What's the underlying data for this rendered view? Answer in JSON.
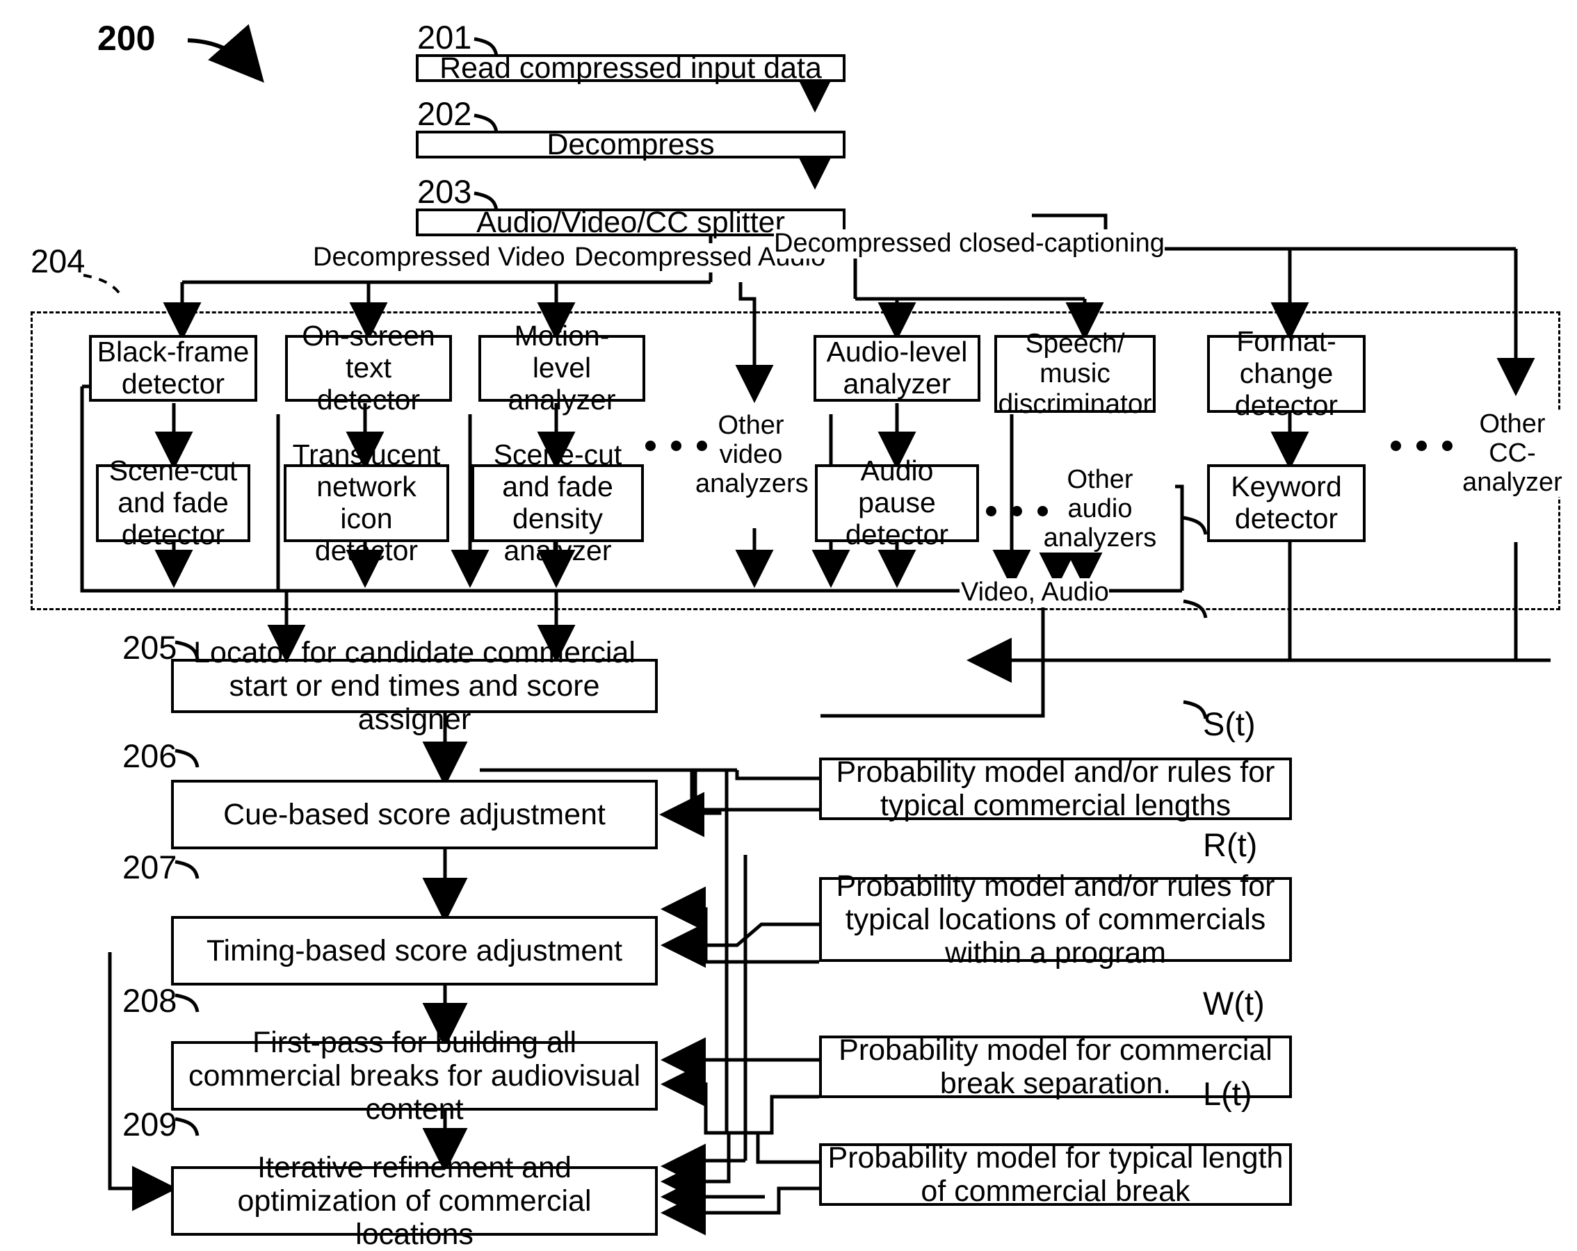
{
  "figure": {
    "number": "200"
  },
  "refs": {
    "r201": "201",
    "r202": "202",
    "r203": "203",
    "r204": "204",
    "r205": "205",
    "r206": "206",
    "r207": "207",
    "r208": "208",
    "r209": "209",
    "st": "S(t)",
    "rt": "R(t)",
    "wt": "W(t)",
    "lt": "L(t)"
  },
  "pipeline": {
    "read": "Read compressed input data",
    "decompress": "Decompress",
    "splitter": "Audio/Video/CC splitter",
    "locator": "Locator for candidate commercial start or end times and score assigner",
    "cue": "Cue-based score adjustment",
    "timing": "Timing-based score adjustment",
    "firstpass": "First-pass for building all commercial breaks for audiovisual content",
    "iterative": "Iterative refinement and optimization of commercial locations"
  },
  "signals": {
    "video": "Decompressed Video",
    "audio": "Decompressed Audio",
    "cc": "Decompressed closed-captioning",
    "video_audio": "Video, Audio"
  },
  "analyzers": {
    "black_frame": "Black-frame detector",
    "scene_cut_fade": "Scene-cut and fade detector",
    "onscreen_text": "On-screen text detector",
    "translucent_icon": "Translucent network icon detector",
    "motion_level": "Motion-level analyzer",
    "scene_cut_density": "Scene-cut and fade density analyzer",
    "other_video": "Other video analyzers",
    "audio_level": "Audio-level analyzer",
    "audio_pause": "Audio pause detector",
    "speech_music": "Speech/ music discriminator",
    "other_audio": "Other audio analyzers",
    "format_change": "Format- change detector",
    "keyword": "Keyword detector",
    "other_cc": "Other CC- analyzer"
  },
  "models": {
    "lengths": "Probability model and/or rules for typical commercial lengths",
    "locations": "Probability model and/or rules for typical locations of commercials within a program",
    "separation": "Probability model for commercial break separation.",
    "break_length": "Probability model for typical length of commercial break"
  }
}
